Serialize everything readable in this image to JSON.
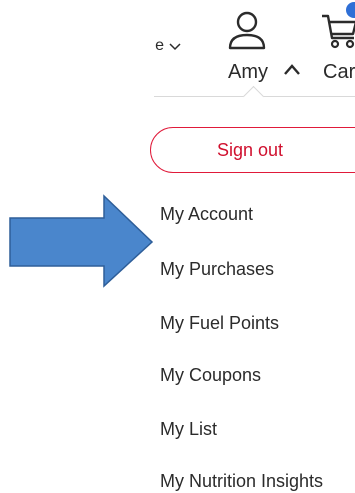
{
  "header": {
    "partial_nav_label": "e",
    "user_name": "Amy",
    "cart_label": "Car"
  },
  "dropdown": {
    "signout_label": "Sign out",
    "menu_items": [
      {
        "label": "My Account"
      },
      {
        "label": "My Purchases"
      },
      {
        "label": "My Fuel Points"
      },
      {
        "label": "My Coupons"
      },
      {
        "label": "My List"
      },
      {
        "label": "My Nutrition Insights"
      }
    ]
  },
  "colors": {
    "signout_accent": "#d0102e",
    "badge": "#2f6fd6",
    "arrow_fill": "#4a86cc",
    "arrow_stroke": "#2e5e99"
  },
  "icons": {
    "user": "person-icon",
    "cart": "cart-icon",
    "annotation": "arrow-right-icon"
  }
}
